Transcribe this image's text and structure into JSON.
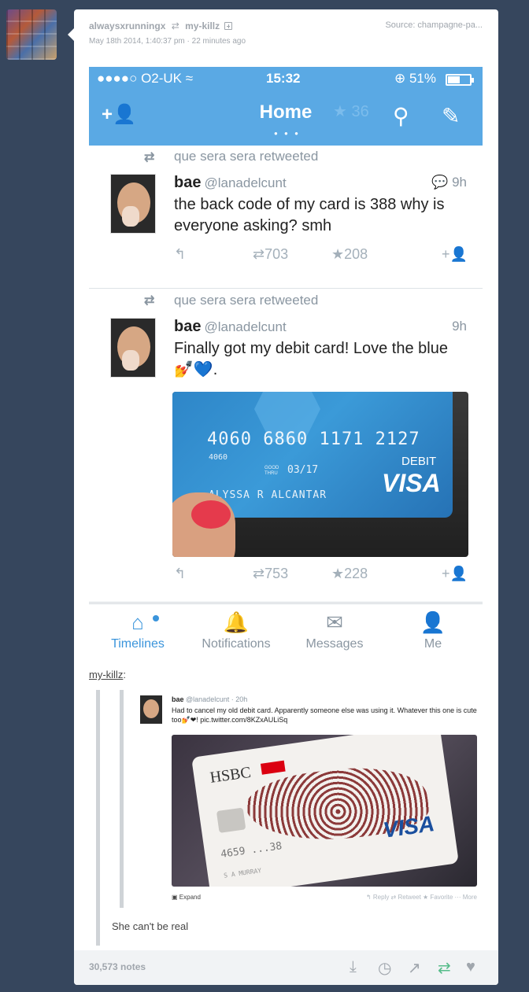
{
  "post": {
    "reblogger": "alwaysxrunningx",
    "reblog_symbol": "⇄",
    "reblogged_from": "my-killz",
    "timestamp": "May 18th 2014, 1:40:37 pm · 22 minutes ago",
    "source": "Source: champagne-pa..."
  },
  "phone": {
    "carrier": "●●●●○ O2-UK ≈",
    "time": "15:32",
    "battery": "⊕ 51%",
    "battery_level": 0.51,
    "nav_title": "Home",
    "nav_dots": "● ● ●",
    "ghost_count": "36"
  },
  "tweets": [
    {
      "retweeted_by": "que sera sera retweeted",
      "name": "bae",
      "handle": "@lanadelcunt",
      "time": "9h",
      "text": "the back code of my card is 388 why is everyone asking? smh",
      "retweets": "703",
      "favorites": "208"
    },
    {
      "retweeted_by": "que sera sera retweeted",
      "name": "bae",
      "handle": "@lanadelcunt",
      "time": "9h",
      "text": "Finally got my debit card! Love the blue 💅💙.",
      "retweets": "753",
      "favorites": "228"
    }
  ],
  "card": {
    "number": "4060 6860 1171 2127",
    "small_number": "4060",
    "good_thru": "GOOD THRU",
    "expiry": "03/17",
    "type": "DEBIT",
    "brand": "VISA",
    "holder": "ALYSSA R ALCANTAR"
  },
  "tabs": [
    {
      "label": "Timelines",
      "icon": "home-icon"
    },
    {
      "label": "Notifications",
      "icon": "bell-icon"
    },
    {
      "label": "Messages",
      "icon": "envelope-icon"
    },
    {
      "label": "Me",
      "icon": "person-icon"
    }
  ],
  "reblog": {
    "user": "my-killz",
    "colon": ":",
    "caption": "She can't be real"
  },
  "embed": {
    "name": "bae",
    "meta": "@lanadelcunt · 20h",
    "text": "Had to cancel my old debit card. Apparently someone else was using it. Whatever this one is cute too💅❤! pic.twitter.com/8KZxAULiSq",
    "expand": "Expand",
    "actions": "↰ Reply   ⇄ Retweet   ★ Favorite   ··· More",
    "card_bank": "HSBC",
    "card_number": "4659 ...38",
    "card_brand": "VISA",
    "card_holder": "S A MURRAY"
  },
  "footer": {
    "notes": "30,573 notes"
  }
}
